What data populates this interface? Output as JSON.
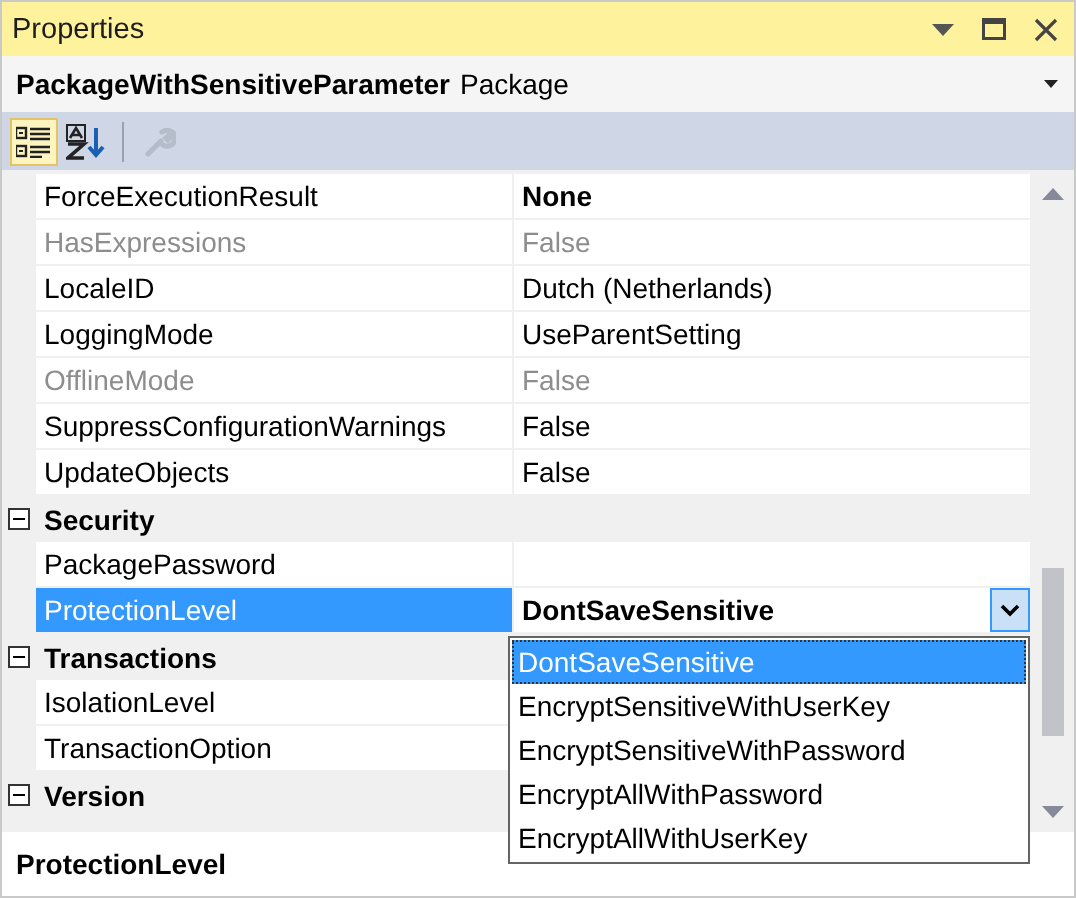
{
  "window": {
    "title": "Properties"
  },
  "object": {
    "name": "PackageWithSensitiveParameter",
    "type": "Package"
  },
  "toolbar": [
    {
      "kind": "categorized",
      "selected": true,
      "disabled": false
    },
    {
      "kind": "alphabetical",
      "selected": false,
      "disabled": false
    },
    {
      "kind": "property-pages",
      "selected": false,
      "disabled": true
    }
  ],
  "sections": [
    {
      "properties": [
        {
          "name": "ForceExecutionResult",
          "value": "None",
          "modified": true,
          "disabled": false,
          "selected": false
        },
        {
          "name": "HasExpressions",
          "value": "False",
          "modified": false,
          "disabled": true,
          "selected": false
        },
        {
          "name": "LocaleID",
          "value": "Dutch (Netherlands)",
          "modified": false,
          "disabled": false,
          "selected": false
        },
        {
          "name": "LoggingMode",
          "value": "UseParentSetting",
          "modified": false,
          "disabled": false,
          "selected": false
        },
        {
          "name": "OfflineMode",
          "value": "False",
          "modified": false,
          "disabled": true,
          "selected": false
        },
        {
          "name": "SuppressConfigurationWarnings",
          "value": "False",
          "modified": false,
          "disabled": false,
          "selected": false
        },
        {
          "name": "UpdateObjects",
          "value": "False",
          "modified": false,
          "disabled": false,
          "selected": false
        }
      ]
    },
    {
      "heading": "Security",
      "expanded": true,
      "properties": [
        {
          "name": "PackagePassword",
          "disabled": false,
          "selected": false
        },
        {
          "name": "ProtectionLevel",
          "value": "DontSaveSensitive",
          "modified": true,
          "disabled": false,
          "selected": true,
          "dropdown": true
        }
      ]
    },
    {
      "heading": "Transactions",
      "expanded": true,
      "properties": [
        {
          "name": "IsolationLevel",
          "disabled": false,
          "selected": false
        },
        {
          "name": "TransactionOption",
          "disabled": false,
          "selected": false
        }
      ]
    },
    {
      "heading": "Version",
      "expanded": true
    }
  ],
  "dropdown_options": [
    {
      "label": "DontSaveSensitive",
      "selected": true
    },
    {
      "label": "EncryptSensitiveWithUserKey",
      "selected": false
    },
    {
      "label": "EncryptSensitiveWithPassword",
      "selected": false
    },
    {
      "label": "EncryptAllWithPassword",
      "selected": false
    },
    {
      "label": "EncryptAllWithUserKey",
      "selected": false
    }
  ],
  "description": {
    "title": "ProtectionLevel"
  }
}
